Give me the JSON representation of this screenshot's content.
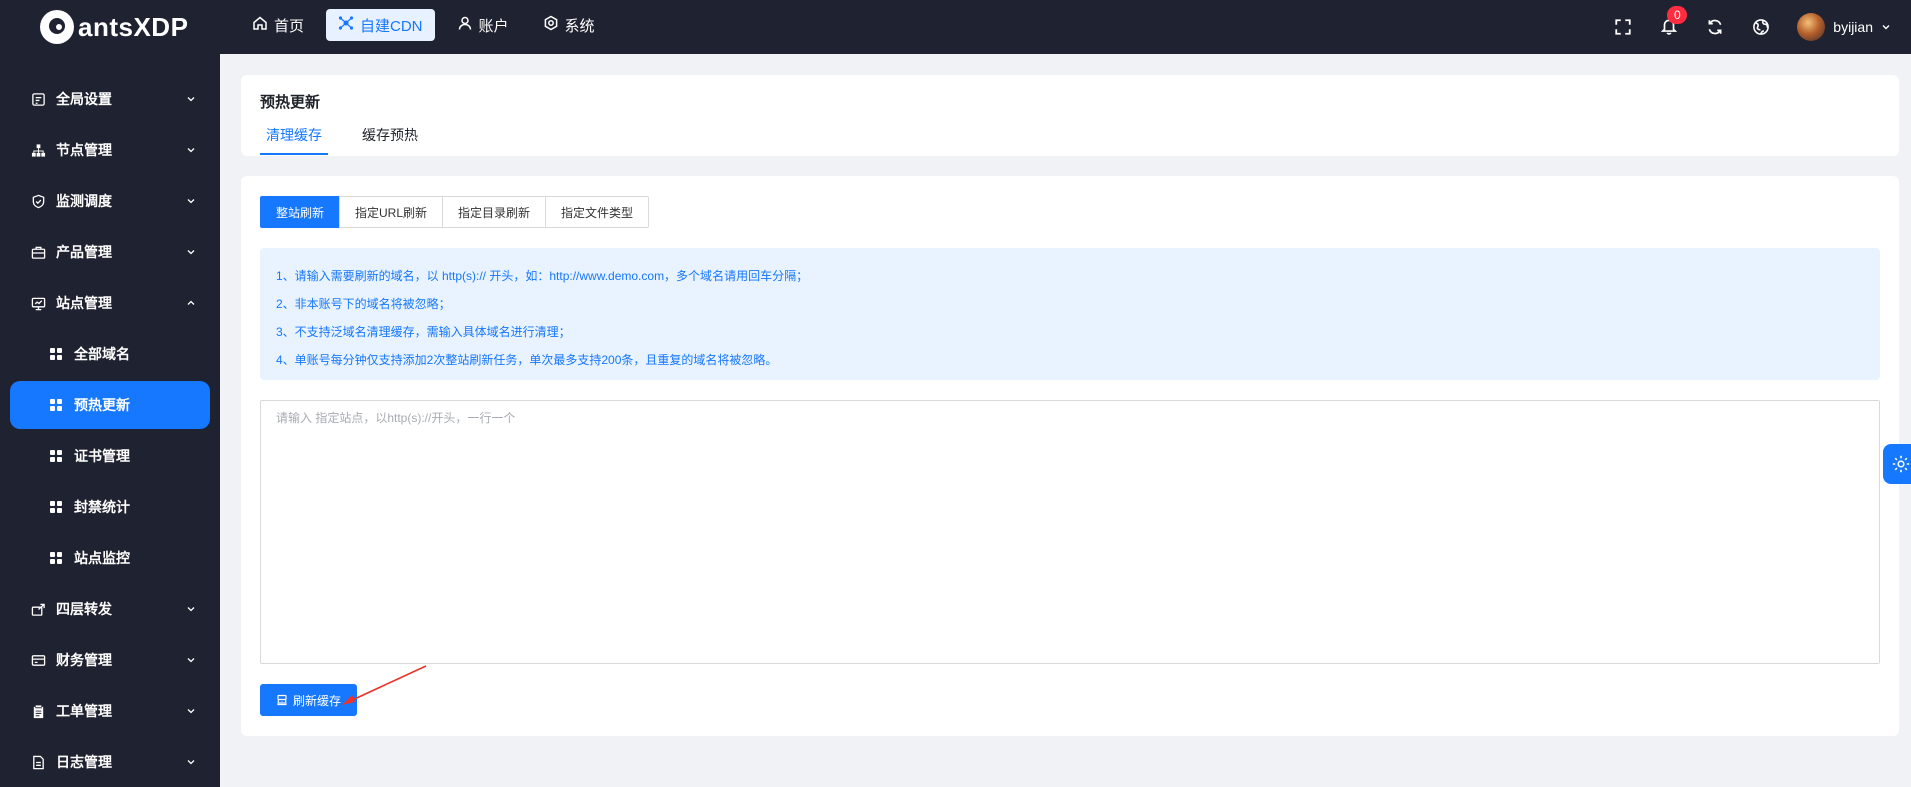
{
  "app": {
    "logo_text": "antsXDP"
  },
  "topnav": [
    {
      "label": "首页",
      "icon": "home-icon"
    },
    {
      "label": "自建CDN",
      "icon": "network-icon",
      "active": true
    },
    {
      "label": "账户",
      "icon": "user-icon"
    },
    {
      "label": "系统",
      "icon": "settings-icon"
    }
  ],
  "topright": {
    "notification_count": "0",
    "username": "byijian"
  },
  "sidebar": {
    "items": [
      {
        "label": "全局设置",
        "icon": "global-settings-icon"
      },
      {
        "label": "节点管理",
        "icon": "hierarchy-icon"
      },
      {
        "label": "监测调度",
        "icon": "shield-icon"
      },
      {
        "label": "产品管理",
        "icon": "product-icon"
      },
      {
        "label": "站点管理",
        "icon": "monitor-icon",
        "expanded": true,
        "children": [
          {
            "label": "全部域名"
          },
          {
            "label": "预热更新",
            "active": true
          },
          {
            "label": "证书管理"
          },
          {
            "label": "封禁统计"
          },
          {
            "label": "站点监控"
          }
        ]
      },
      {
        "label": "四层转发",
        "icon": "forward-icon"
      },
      {
        "label": "财务管理",
        "icon": "card-icon"
      },
      {
        "label": "工单管理",
        "icon": "clipboard-icon"
      },
      {
        "label": "日志管理",
        "icon": "log-icon"
      }
    ]
  },
  "page": {
    "title": "预热更新",
    "tabs": [
      {
        "label": "清理缓存",
        "active": true
      },
      {
        "label": "缓存预热"
      }
    ]
  },
  "refresh_modes": [
    {
      "label": "整站刷新",
      "active": true
    },
    {
      "label": "指定URL刷新"
    },
    {
      "label": "指定目录刷新"
    },
    {
      "label": "指定文件类型"
    }
  ],
  "notice": [
    "1、请输入需要刷新的域名，以 http(s):// 开头，如：http://www.demo.com，多个域名请用回车分隔；",
    "2、非本账号下的域名将被忽略；",
    "3、不支持泛域名清理缓存，需输入具体域名进行清理；",
    "4、单账号每分钟仅支持添加2次整站刷新任务，单次最多支持200条，且重复的域名将被忽略。"
  ],
  "input": {
    "value": "",
    "placeholder": "请输入 指定站点，以http(s)://开头，一行一个"
  },
  "submit": {
    "label": "刷新缓存"
  },
  "colors": {
    "primary": "#1677ff",
    "sidebar_bg": "#1f2230",
    "notice_bg": "#e8f3ff",
    "badge": "#ff2d3f"
  }
}
